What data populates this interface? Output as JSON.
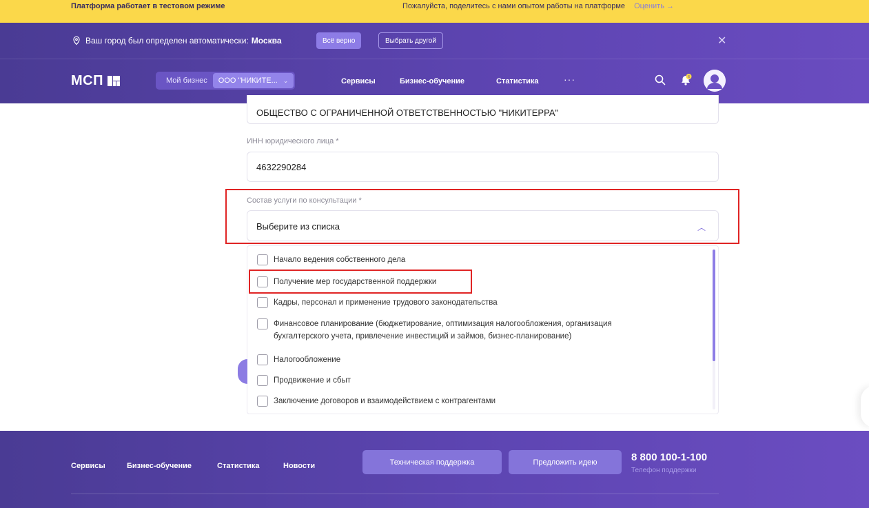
{
  "banner": {
    "test_mode": "Платформа работает в тестовом режиме",
    "feedback": "Пожалуйста, поделитесь с нами опытом работы на платформе",
    "rate_link": "Оценить →"
  },
  "geo": {
    "text": "Ваш город был определен автоматически:",
    "city": "Москва",
    "confirm_label": "Всё верно",
    "other_label": "Выбрать другой",
    "close_glyph": "✕"
  },
  "header": {
    "logo": "МСП",
    "my_business_label": "Мой бизнес",
    "company_selected": "ООО \"НИКИТЕ...",
    "nav": [
      "Сервисы",
      "Бизнес-обучение",
      "Статистика"
    ],
    "more": "···",
    "notifications_count": "6"
  },
  "form": {
    "company_name_value": "ОБЩЕСТВО С ОГРАНИЧЕННОЙ ОТВЕТСТВЕННОСТЬЮ  \"НИКИТЕРРА\"",
    "inn_label": "ИНН юридического лица *",
    "inn_value": "4632290284",
    "service_label": "Состав услуги по консультации *",
    "service_placeholder": "Выберите из списка",
    "options": [
      "Начало ведения собственного дела",
      "Получение мер государственной поддержки",
      "Кадры, персонал и применение трудового законодательства",
      "Финансовое планирование (бюджетирование, оптимизация налогообложения, организация",
      "бухгалтерского учета, привлечение инвестиций и займов, бизнес-планирование)",
      "Налогообложение",
      "Продвижение и сбыт",
      "Заключение договоров и взаимодействием с контрагентами"
    ]
  },
  "footer": {
    "links": [
      "Сервисы",
      "Бизнес-обучение",
      "Статистика",
      "Новости"
    ],
    "support_label": "Техническая поддержка",
    "idea_label": "Предложить идею",
    "phone": "8 800 100-1-100",
    "phone_caption": "Телефон поддержки"
  },
  "colors": {
    "brand_purple": "#5e45b3",
    "banner_yellow": "#fbd84a",
    "highlight_red": "#e02424",
    "accent_light": "#8d7ce6"
  }
}
